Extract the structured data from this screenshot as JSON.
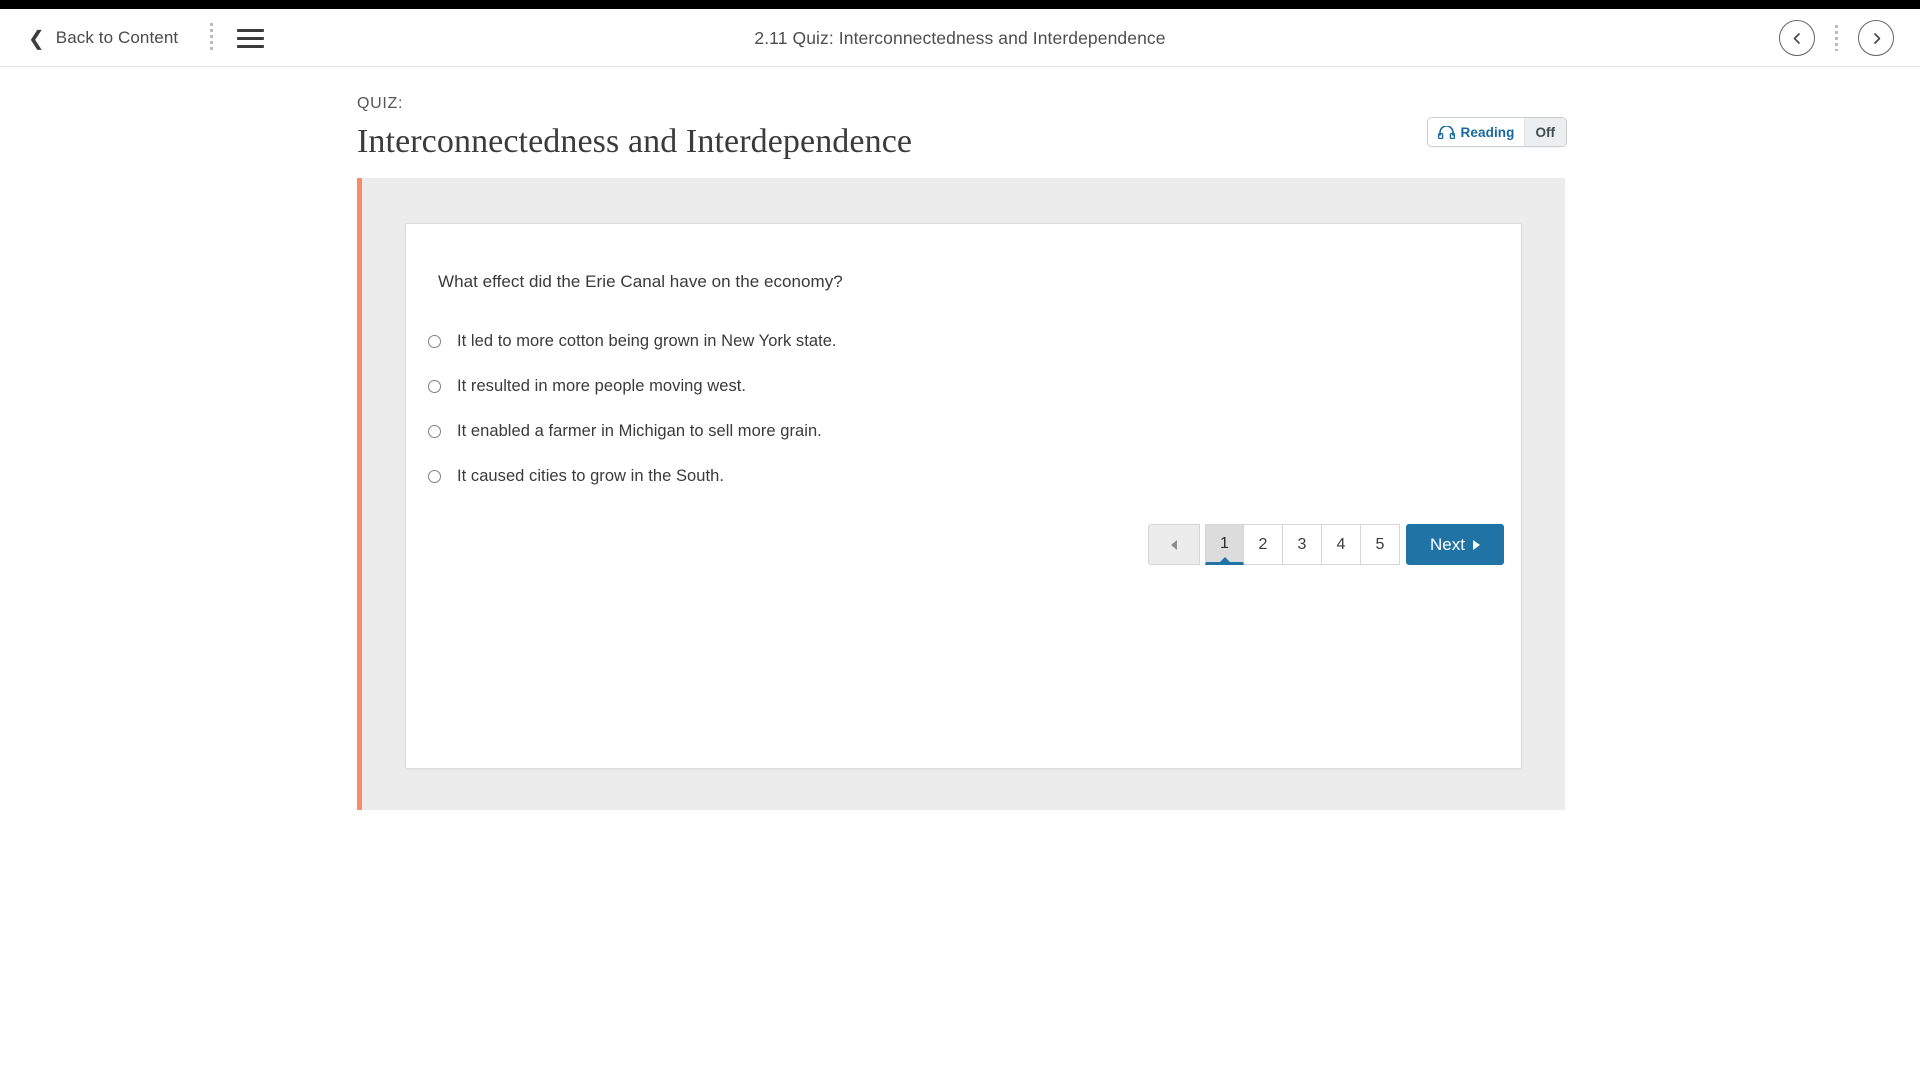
{
  "header": {
    "back_label": "Back to Content",
    "title": "2.11 Quiz: Interconnectedness and Interdependence",
    "menu_icon": "hamburger-icon",
    "prev_icon": "chevron-left-circle-icon",
    "next_icon": "chevron-right-circle-icon"
  },
  "quiz": {
    "eyebrow": "QUIZ:",
    "title": "Interconnectedness and Interdependence"
  },
  "reading": {
    "icon": "headphones-icon",
    "label": "Reading",
    "state": "Off"
  },
  "question": {
    "prompt": "What effect did the Erie Canal have on the economy?",
    "options": [
      {
        "label": "It led to more cotton being grown in New York state.",
        "selected": false
      },
      {
        "label": "It resulted in more people moving west.",
        "selected": false
      },
      {
        "label": "It enabled a farmer in Michigan to sell more grain.",
        "selected": false
      },
      {
        "label": "It caused cities to grow in the South.",
        "selected": false
      }
    ]
  },
  "pagination": {
    "prev_icon": "triangle-left-icon",
    "pages": [
      "1",
      "2",
      "3",
      "4",
      "5"
    ],
    "active_page": "1",
    "next_label": "Next",
    "next_icon": "triangle-right-icon"
  },
  "colors": {
    "accent_bar": "#f98b68",
    "primary_blue": "#1f74a5",
    "panel_gray": "#ececec",
    "reading_blue": "#17699e"
  }
}
